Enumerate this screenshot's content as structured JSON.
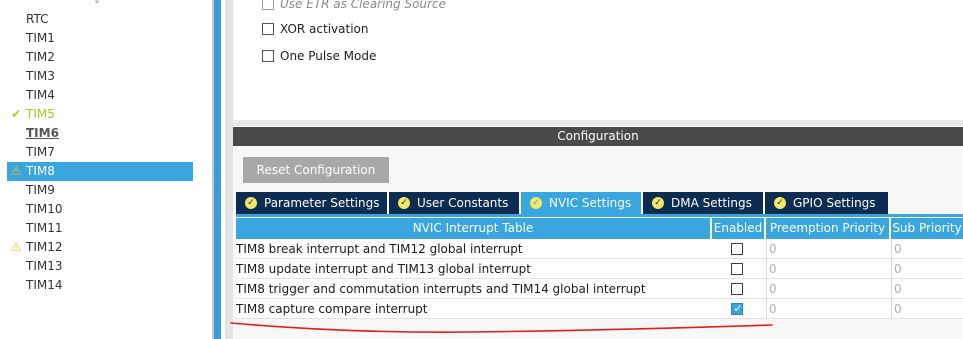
{
  "sidebar": {
    "items": [
      {
        "label": "RTC",
        "status": "none"
      },
      {
        "label": "TIM1",
        "status": "none"
      },
      {
        "label": "TIM2",
        "status": "none"
      },
      {
        "label": "TIM3",
        "status": "none"
      },
      {
        "label": "TIM4",
        "status": "none"
      },
      {
        "label": "TIM5",
        "status": "ok"
      },
      {
        "label": "TIM6",
        "status": "inuse"
      },
      {
        "label": "TIM7",
        "status": "none"
      },
      {
        "label": "TIM8",
        "status": "warning-selected"
      },
      {
        "label": "TIM9",
        "status": "none"
      },
      {
        "label": "TIM10",
        "status": "none"
      },
      {
        "label": "TIM11",
        "status": "none"
      },
      {
        "label": "TIM12",
        "status": "warning"
      },
      {
        "label": "TIM13",
        "status": "none"
      },
      {
        "label": "TIM14",
        "status": "none"
      }
    ],
    "ok_icon": "✔",
    "warn_icon": "⚠"
  },
  "mode": {
    "options": [
      {
        "label": "Use ETR as Clearing Source",
        "checked": false
      },
      {
        "label": "XOR activation",
        "checked": false
      },
      {
        "label": "One Pulse Mode",
        "checked": false
      }
    ]
  },
  "config": {
    "header": "Configuration",
    "reset_label": "Reset Configuration",
    "tabs": [
      {
        "label": "Parameter Settings",
        "active": false
      },
      {
        "label": "User Constants",
        "active": false
      },
      {
        "label": "NVIC Settings",
        "active": true
      },
      {
        "label": "DMA Settings",
        "active": false
      },
      {
        "label": "GPIO Settings",
        "active": false
      }
    ],
    "tab_check_icon": "✓"
  },
  "nvic": {
    "headers": {
      "name": "NVIC Interrupt Table",
      "enabled": "Enabled",
      "preemption": "Preemption Priority",
      "sub": "Sub Priority"
    },
    "rows": [
      {
        "name": "TIM8 break interrupt and TIM12 global interrupt",
        "enabled": false,
        "preemption": "0",
        "sub": "0"
      },
      {
        "name": "TIM8 update interrupt and TIM13 global interrupt",
        "enabled": false,
        "preemption": "0",
        "sub": "0"
      },
      {
        "name": "TIM8 trigger and commutation interrupts and TIM14 global interrupt",
        "enabled": false,
        "preemption": "0",
        "sub": "0"
      },
      {
        "name": "TIM8 capture compare interrupt",
        "enabled": true,
        "preemption": "0",
        "sub": "0"
      }
    ]
  },
  "colors": {
    "accent_blue": "#39a6e0",
    "tab_navy": "#0d2c52",
    "config_header": "#4a4a4a",
    "ok_green": "#9ecf1a",
    "warn_yellow": "#f5c400",
    "annotation_red": "#e0201a"
  },
  "annotation": {
    "type": "hand-drawn-underline",
    "color": "red"
  }
}
